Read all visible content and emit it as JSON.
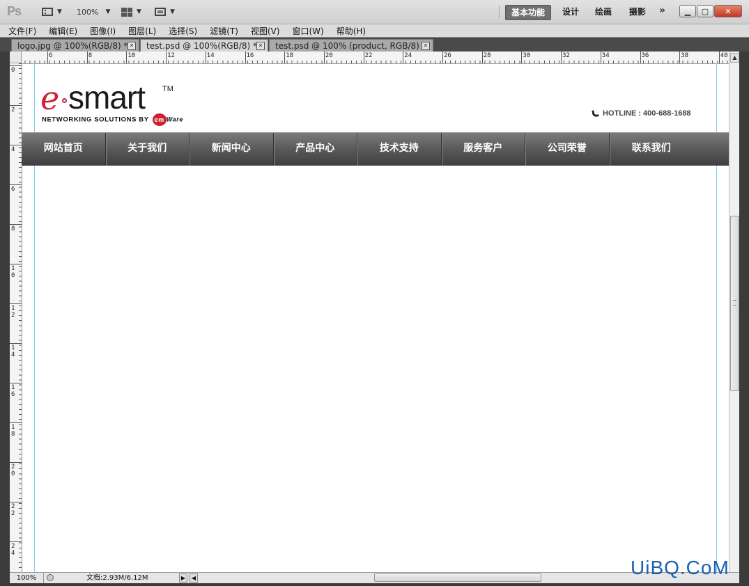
{
  "app": {
    "logo": "Ps",
    "zoom_select": "100%",
    "workspaces": [
      "基本功能",
      "设计",
      "绘画",
      "摄影"
    ],
    "active_workspace": "基本功能",
    "more_workspaces": "»"
  },
  "menu": [
    "文件(F)",
    "编辑(E)",
    "图像(I)",
    "图层(L)",
    "选择(S)",
    "滤镜(T)",
    "视图(V)",
    "窗口(W)",
    "帮助(H)"
  ],
  "tabs": [
    {
      "label": "logo.jpg @ 100%(RGB/8) *",
      "active": false
    },
    {
      "label": "test.psd @ 100%(RGB/8) *",
      "active": true
    },
    {
      "label": "test.psd @ 100% (product, RGB/8) *",
      "active": false
    }
  ],
  "ruler": {
    "h_labels": [
      "6",
      "8",
      "10",
      "12",
      "14",
      "16",
      "18",
      "20",
      "22",
      "24",
      "26",
      "28",
      "30",
      "32",
      "34",
      "36",
      "38",
      "40"
    ],
    "v_labels": [
      "0",
      "2",
      "4",
      "6",
      "8",
      "10",
      "12",
      "14",
      "16",
      "18",
      "20",
      "22",
      "24"
    ]
  },
  "page": {
    "logo": {
      "e": "e",
      "smart": "smart",
      "tm": "TM",
      "tagline": "NETWORKING SOLUTIONS BY",
      "em": "em",
      "ware": "Ware"
    },
    "hotline": "HOTLINE : 400-688-1688",
    "nav": [
      "网站首页",
      "关于我们",
      "新闻中心",
      "产品中心",
      "技术支持",
      "服务客户",
      "公司荣誉",
      "联系我们"
    ]
  },
  "status": {
    "zoom": "100%",
    "doc": "文档:2.93M/6.12M"
  },
  "watermark": "UiBQ.CoM",
  "colors": {
    "brand_red": "#cc2233",
    "guide": "#7fd4ea",
    "nav_dark": "#4a4a4a"
  }
}
